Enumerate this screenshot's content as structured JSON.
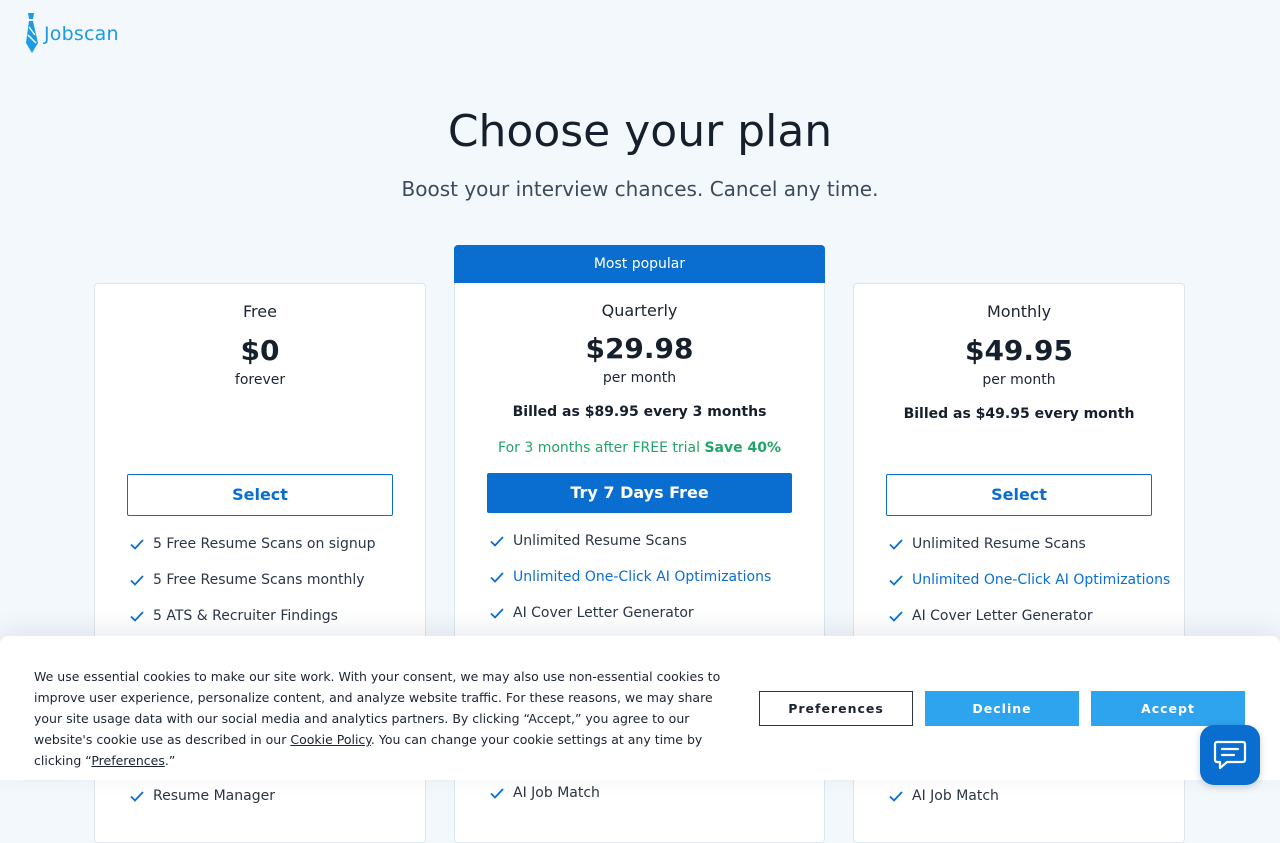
{
  "brand": {
    "name": "Jobscan",
    "color": "#1e9be4"
  },
  "header": {
    "title": "Choose your plan",
    "subtitle": "Boost your interview chances. Cancel any time."
  },
  "plans": {
    "free": {
      "name": "Free",
      "price": "$0",
      "period": "forever",
      "button": "Select",
      "features": [
        "5 Free Resume Scans on signup",
        "5 Free Resume Scans monthly",
        "5 ATS & Recruiter Findings",
        "Resume Manager"
      ]
    },
    "quarterly": {
      "badge": "Most popular",
      "name": "Quarterly",
      "price": "$29.98",
      "period": "per month",
      "billed": "Billed as $89.95 every 3 months",
      "trial_note": "For 3 months after FREE trial",
      "save": "Save 40%",
      "button": "Try 7 Days Free",
      "features": [
        "Unlimited Resume Scans",
        "Unlimited One-Click AI Optimizations",
        "AI Cover Letter Generator",
        "AI Job Match"
      ]
    },
    "monthly": {
      "name": "Monthly",
      "price": "$49.95",
      "period": "per month",
      "billed": "Billed as $49.95 every month",
      "button": "Select",
      "features": [
        "Unlimited Resume Scans",
        "Unlimited One-Click AI Optimizations",
        "AI Cover Letter Generator",
        "AI Job Match"
      ]
    }
  },
  "cookie_banner": {
    "text_1": "We use essential cookies to make our site work. With your consent, we may also use non-essential cookies to improve user experience, personalize content, and analyze website traffic. For these reasons, we may share your site usage data with our social media and analytics partners. By clicking “Accept,” you agree to our website's cookie use as described in our ",
    "policy_link": "Cookie Policy",
    "text_2": ". You can change your cookie settings at any time by clicking “",
    "preferences_link": "Preferences",
    "text_3": ".”",
    "preferences_button": "Preferences",
    "decline_button": "Decline",
    "accept_button": "Accept"
  },
  "colors": {
    "primary": "#0a6ed1",
    "accent": "#2ea3ee",
    "success": "#21a36a",
    "background": "#f3f8fc"
  }
}
